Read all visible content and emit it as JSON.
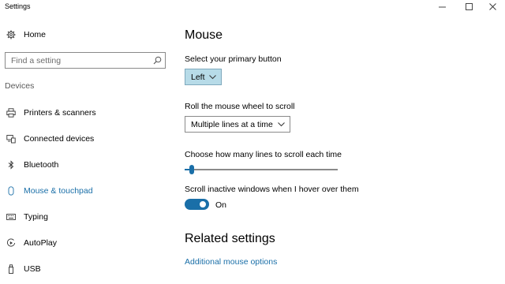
{
  "window": {
    "title": "Settings"
  },
  "sidebar": {
    "home_label": "Home",
    "search_placeholder": "Find a setting",
    "section_label": "Devices",
    "items": [
      {
        "label": "Printers & scanners",
        "icon": "printer-icon"
      },
      {
        "label": "Connected devices",
        "icon": "connected-devices-icon"
      },
      {
        "label": "Bluetooth",
        "icon": "bluetooth-icon"
      },
      {
        "label": "Mouse & touchpad",
        "icon": "mouse-icon",
        "active": true
      },
      {
        "label": "Typing",
        "icon": "keyboard-icon"
      },
      {
        "label": "AutoPlay",
        "icon": "autoplay-icon"
      },
      {
        "label": "USB",
        "icon": "usb-icon"
      }
    ]
  },
  "main": {
    "title": "Mouse",
    "primary_button": {
      "label": "Select your primary button",
      "value": "Left"
    },
    "scroll_mode": {
      "label": "Roll the mouse wheel to scroll",
      "value": "Multiple lines at a time"
    },
    "lines_to_scroll": {
      "label": "Choose how many lines to scroll each time",
      "level": 0.03
    },
    "inactive_scroll": {
      "label": "Scroll inactive windows when I hover over them",
      "state": "On"
    },
    "related": {
      "title": "Related settings",
      "link": "Additional mouse options"
    }
  },
  "colors": {
    "accent": "#1a6fa8",
    "selected_dropdown": "#b7dbe8"
  }
}
